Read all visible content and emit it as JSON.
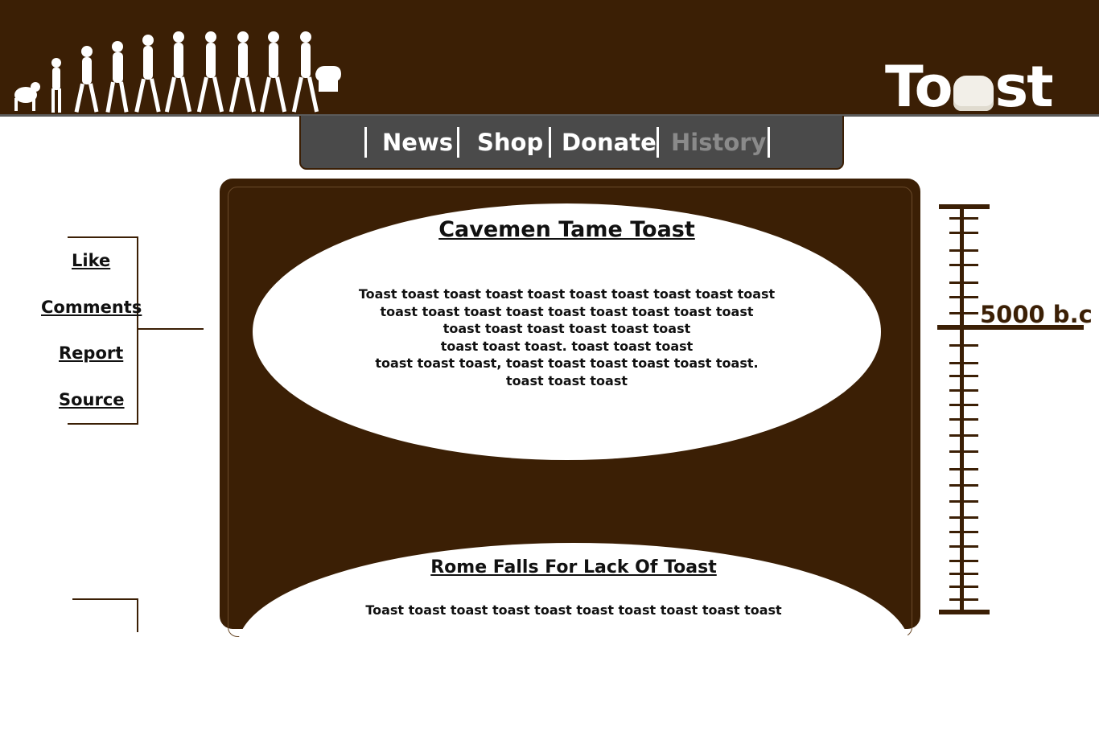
{
  "header": {
    "logo_text_left": "To",
    "logo_text_right": "st"
  },
  "nav": {
    "items": [
      {
        "label": "News"
      },
      {
        "label": "Shop"
      },
      {
        "label": "Donate"
      },
      {
        "label": "History"
      }
    ],
    "current": "History"
  },
  "side": {
    "like_label": "Like",
    "comments_label": "Comments",
    "report_label": "Report",
    "source_label": "Source"
  },
  "articles": [
    {
      "title": "Cavemen Tame Toast",
      "body": "Toast toast toast toast toast toast toast toast toast toast\ntoast toast toast toast toast toast toast toast toast\ntoast toast toast toast toast toast\ntoast toast toast. toast toast toast\ntoast toast toast, toast toast toast toast toast toast.\ntoast toast toast"
    },
    {
      "title": "Rome Falls For Lack Of Toast",
      "body": "Toast toast toast toast toast toast toast toast toast toast"
    }
  ],
  "timeline": {
    "era_label": "5000 b.c"
  },
  "colors": {
    "brand_brown": "#3b1f05",
    "nav_gray": "#4a4a4a",
    "current_nav": "#8a8a8a"
  }
}
